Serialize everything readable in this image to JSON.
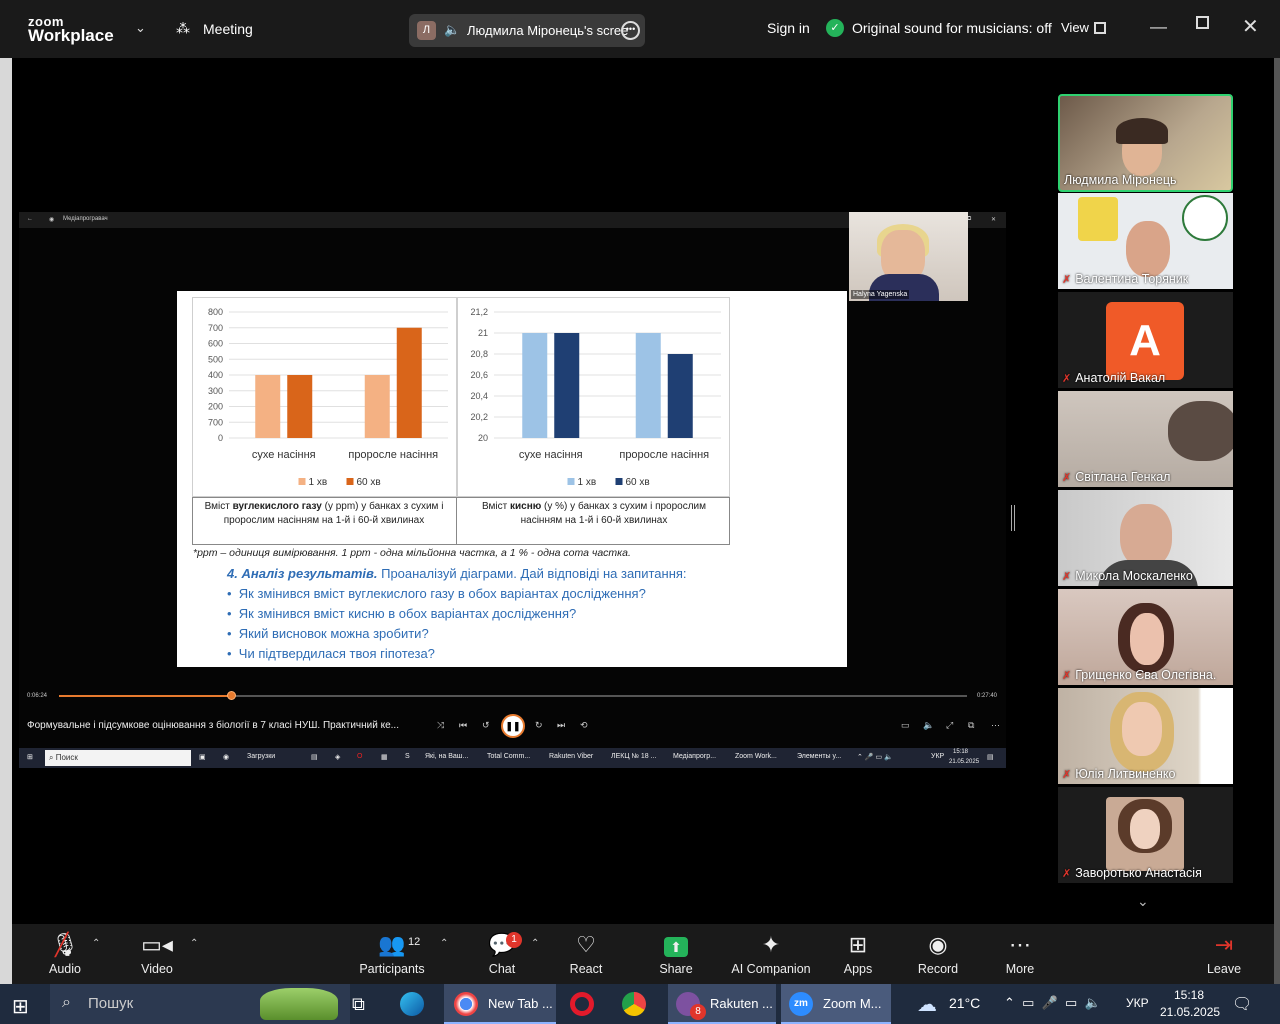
{
  "titlebar": {
    "logo_line1": "zoom",
    "logo_line2": "Workplace",
    "meeting_label": "Meeting",
    "share_pill_initial": "Л",
    "share_pill_text": "Людмила Міронець's scree",
    "signin": "Sign in",
    "original_sound": "Original sound for musicians: off",
    "view": "View"
  },
  "player": {
    "window_title": "Медіапрогравач",
    "pip_name": "Halyna Yagenska",
    "time_elapsed": "0:06:24",
    "time_total": "0:27:40",
    "progress": 0.19,
    "video_title": "Формувальне і підсумкове оцінювання з біології в 7 класі НУШ. Практичний ке...",
    "search_placeholder": "Поиск",
    "taskbar_items": [
      "Загрузки",
      "Які, на Ваш...",
      "Total Comm...",
      "Rakuten Viber",
      "ЛЕКЦ № 18 ...",
      "Медіапрогр...",
      "Zoom Work...",
      "Элементы у..."
    ],
    "tray_lang": "УКР",
    "tray_time": "15:18",
    "tray_date": "21.05.2025"
  },
  "slide": {
    "chart_data": [
      {
        "type": "bar",
        "categories": [
          "сухе насіння",
          "проросле насіння"
        ],
        "series": [
          {
            "name": "1 хв",
            "values": [
              400,
              400
            ],
            "color": "#f4b183"
          },
          {
            "name": "60 хв",
            "values": [
              400,
              700
            ],
            "color": "#d9651a"
          }
        ],
        "ylim": [
          0,
          800
        ],
        "yticks": [
          0,
          100,
          200,
          300,
          400,
          500,
          600,
          700,
          800
        ],
        "ytick_labels": [
          "0",
          "700",
          "200",
          "300",
          "400",
          "500",
          "600",
          "700",
          "800"
        ],
        "legend_position": "bottom",
        "caption_pre": "Вміст ",
        "caption_bold": "вуглекислого газу",
        "caption_post": " (у ppm) у банках з сухим і пророслим насінням на 1-й і 60-й хвилинах"
      },
      {
        "type": "bar",
        "categories": [
          "сухе насіння",
          "проросле насіння"
        ],
        "series": [
          {
            "name": "1 хв",
            "values": [
              21,
              21
            ],
            "color": "#9dc3e6"
          },
          {
            "name": "60 хв",
            "values": [
              21,
              20.8
            ],
            "color": "#1f3f73"
          }
        ],
        "ylim": [
          20,
          21.2
        ],
        "yticks": [
          20,
          20.2,
          20.4,
          20.6,
          20.8,
          21,
          21.2
        ],
        "ytick_labels": [
          "20",
          "20,2",
          "20,4",
          "20,6",
          "20,8",
          "21",
          "21,2"
        ],
        "legend_position": "bottom",
        "caption_pre": "Вміст ",
        "caption_bold": "кисню",
        "caption_post": " (у %) у банках з сухим і пророслим насінням на 1-й і 60-й хвилинах"
      }
    ],
    "note": "*ppm – одиниця вимірювання. 1 ppm - одна мільйонна частка, а 1 % - одна сота частка.",
    "heading_bold": "4. Аналіз результатів.",
    "heading_rest": " Проаналізуй діаграми. Дай відповіді на запитання:",
    "bullets": [
      "Як змінився вміст вуглекислого газу в обох варіантах дослідження?",
      "Як змінився вміст кисню в обох варіантах дослідження?",
      "Який висновок можна зробити?",
      "Чи підтвердилася твоя гіпотеза?"
    ]
  },
  "participants": [
    {
      "name": "Людмила Міронець",
      "muted": false
    },
    {
      "name": "Валентина Торяник",
      "muted": true
    },
    {
      "name": "Анатолій Вакал",
      "muted": true,
      "initial": "A"
    },
    {
      "name": "Світлана Генкал",
      "muted": true
    },
    {
      "name": "Микола Москаленко",
      "muted": true
    },
    {
      "name": "Грищенко Єва Олегівна.",
      "muted": true
    },
    {
      "name": "Юлія Литвиненко",
      "muted": true
    },
    {
      "name": "Заворотько Анастасія",
      "muted": true
    }
  ],
  "toolbar": {
    "audio": "Audio",
    "video": "Video",
    "participants": "Participants",
    "participants_count": "12",
    "chat": "Chat",
    "chat_badge": "1",
    "react": "React",
    "share": "Share",
    "ai": "AI Companion",
    "apps": "Apps",
    "record": "Record",
    "more": "More",
    "leave": "Leave"
  },
  "wintaskbar": {
    "search": "Пошук",
    "items": [
      "New Tab ...",
      "Rakuten ...",
      "Zoom M..."
    ],
    "viber_badge": "8",
    "temp": "21°C",
    "lang": "УКР",
    "time": "15:18",
    "date": "21.05.2025"
  }
}
